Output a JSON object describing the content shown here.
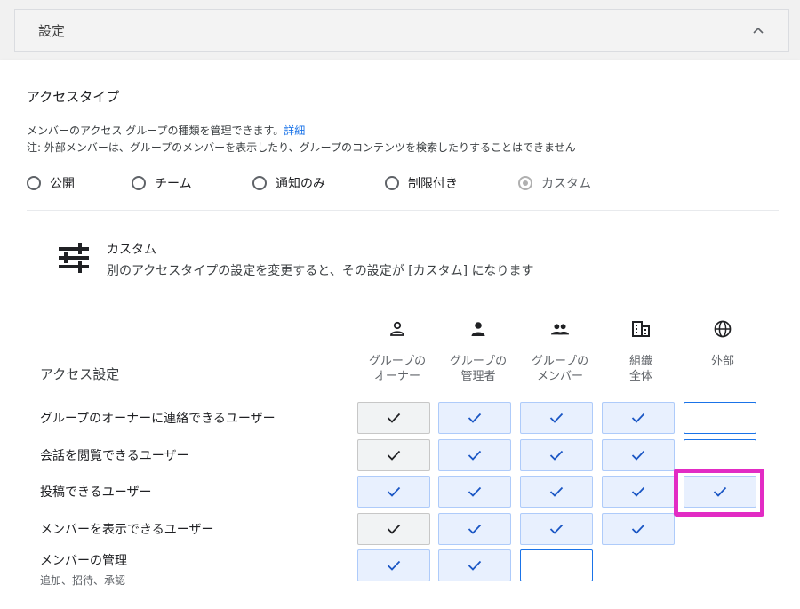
{
  "header": {
    "title": "設定"
  },
  "section": {
    "title": "アクセスタイプ",
    "desc_line1": "メンバーのアクセス グループの種類を管理できます。",
    "details_link": "詳細",
    "desc_line2": "注: 外部メンバーは、グループのメンバーを表示したり、グループのコンテンツを検索したりすることはできません"
  },
  "radios": [
    {
      "label": "公開",
      "selected": false,
      "disabled": false
    },
    {
      "label": "チーム",
      "selected": false,
      "disabled": false
    },
    {
      "label": "通知のみ",
      "selected": false,
      "disabled": false
    },
    {
      "label": "制限付き",
      "selected": false,
      "disabled": false
    },
    {
      "label": "カスタム",
      "selected": true,
      "disabled": true
    }
  ],
  "custom": {
    "title": "カスタム",
    "desc": "別のアクセスタイプの設定を変更すると、その設定が [カスタム] になります"
  },
  "access_label": "アクセス設定",
  "columns": [
    {
      "icon": "person-outline-icon",
      "label": "グループの\nオーナー"
    },
    {
      "icon": "person-icon",
      "label": "グループの\n管理者"
    },
    {
      "icon": "people-icon",
      "label": "グループの\nメンバー"
    },
    {
      "icon": "domain-icon",
      "label": "組織\n全体"
    },
    {
      "icon": "globe-icon",
      "label": "外部"
    }
  ],
  "rows": [
    {
      "label": "グループのオーナーに連絡できるユーザー",
      "sub": "",
      "cells": [
        "owner",
        "checked",
        "checked",
        "checked",
        "empty"
      ]
    },
    {
      "label": "会話を閲覧できるユーザー",
      "sub": "",
      "cells": [
        "owner",
        "checked",
        "checked",
        "checked",
        "empty"
      ]
    },
    {
      "label": "投稿できるユーザー",
      "sub": "",
      "cells": [
        "checked",
        "checked",
        "checked",
        "checked",
        "checked"
      ]
    },
    {
      "label": "メンバーを表示できるユーザー",
      "sub": "",
      "cells": [
        "owner",
        "checked",
        "checked",
        "checked",
        "none"
      ]
    },
    {
      "label": "メンバーの管理",
      "sub": "追加、招待、承認",
      "cells": [
        "checked",
        "checked",
        "empty",
        "none",
        "none"
      ]
    }
  ],
  "colors": {
    "accent": "#1a73e8",
    "cell_checked_bg": "#e8f0fe",
    "highlight": "#e22bc4"
  }
}
